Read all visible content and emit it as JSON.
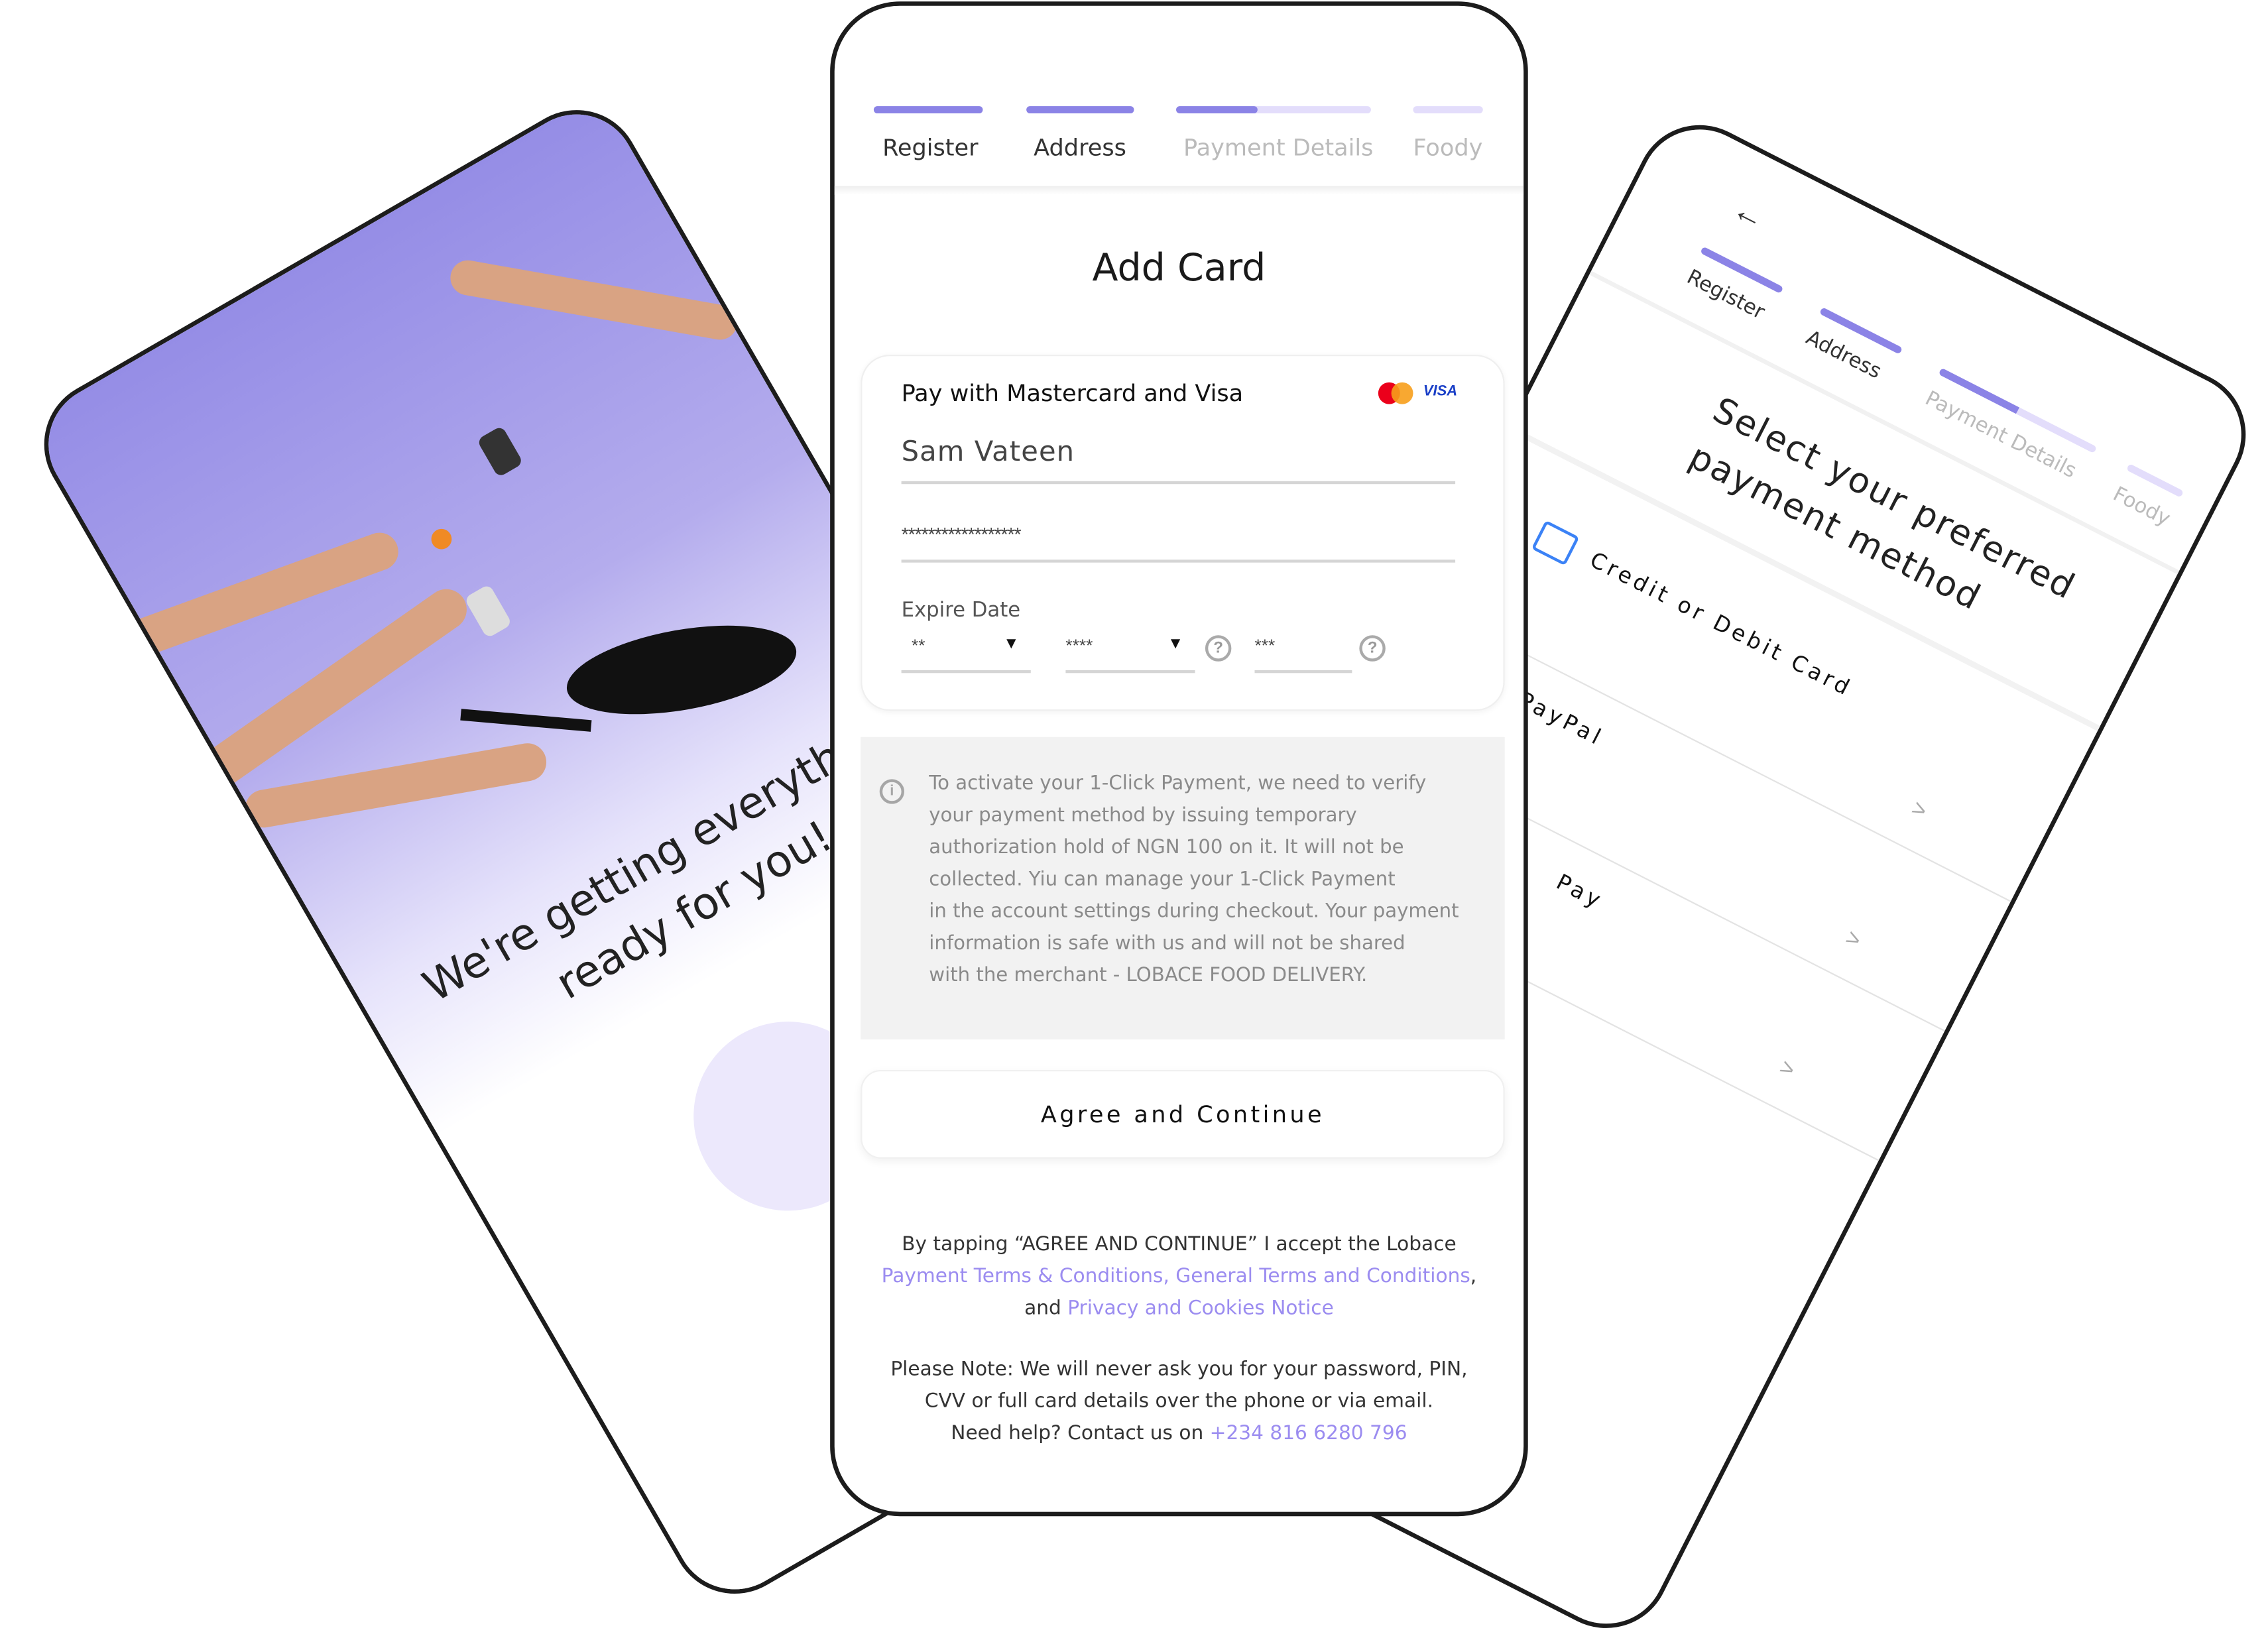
{
  "colors": {
    "accent": "#8b83e6",
    "accent_light": "#e3ddfb",
    "link": "#9b8cf0",
    "info_bg": "#f2f2f2",
    "card_icon": "#3b82f6"
  },
  "left_phone": {
    "headline_line1": "We're getting everything",
    "headline_line2": "ready for you!"
  },
  "right_phone": {
    "back_icon": "arrow-left-icon",
    "steps": [
      {
        "label": "Register",
        "progress": 1
      },
      {
        "label": "Address",
        "progress": 1
      },
      {
        "label": "Payment Details",
        "progress": 0.5
      },
      {
        "label": "Foody",
        "progress": 0
      }
    ],
    "title_line1": "Select your preferred",
    "title_line2": "payment method",
    "methods": [
      {
        "label": "Credit or Debit Card",
        "icon": "card-add-icon"
      },
      {
        "label": "PayPal"
      },
      {
        "label": "Pay"
      }
    ]
  },
  "center_phone": {
    "steps": [
      {
        "label": "Register",
        "progress": 1
      },
      {
        "label": "Address",
        "progress": 1
      },
      {
        "label": "Payment Details",
        "progress": 0.42
      },
      {
        "label": "Foody",
        "progress": 0
      }
    ],
    "title": "Add Card",
    "card": {
      "pay_title": "Pay with Mastercard and Visa",
      "visa_logo": "VISA",
      "cardholder_name": "Sam Vateen",
      "card_number": "******************",
      "expire_label": "Expire Date",
      "month": "**",
      "year": "****",
      "cvv": "***",
      "help_glyph": "?"
    },
    "info": {
      "icon_glyph": "i",
      "lines": [
        "To activate your 1-Click Payment, we need to verify",
        "your payment method by issuing temporary",
        "authorization hold of NGN 100 on it. It will not be",
        "collected. Yiu can manage your 1-Click Payment",
        "in the account settings during checkout. Your payment",
        "information is safe with us and will not be shared",
        "with the merchant - LOBACE FOOD DELIVERY."
      ]
    },
    "agree_button": "Agree and Continue",
    "terms": {
      "prefix": "By tapping “AGREE AND CONTINUE” I accept the Lobace",
      "link1": "Payment Terms & Conditions, General Terms and Conditions",
      "comma": ",",
      "and": "and ",
      "link2": "Privacy and Cookies Notice"
    },
    "note": {
      "line1": "Please Note: We will never ask you for your password, PIN,",
      "line2": "CVV or full card details over the phone or via email.",
      "line3_prefix": "Need help? Contact us on ",
      "phone": "+234 816 6280 796"
    }
  }
}
